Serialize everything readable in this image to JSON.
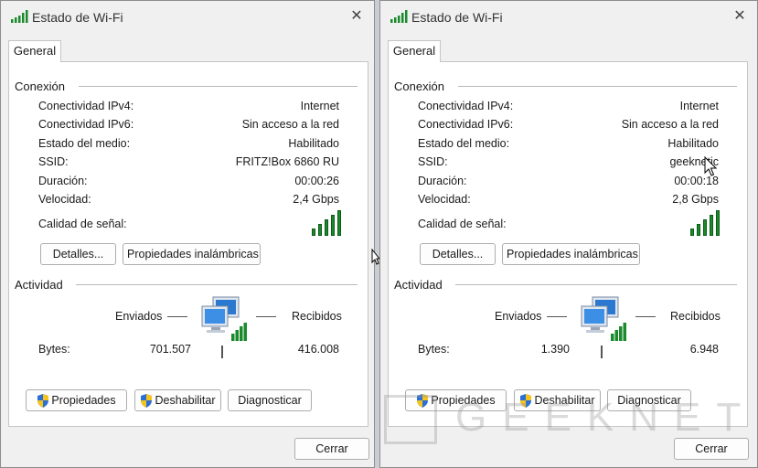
{
  "dialogs": [
    {
      "title": "Estado de Wi-Fi",
      "tab": "General",
      "connection": {
        "group_label": "Conexión",
        "rows": [
          {
            "label": "Conectividad IPv4:",
            "value": "Internet"
          },
          {
            "label": "Conectividad IPv6:",
            "value": "Sin acceso a la red"
          },
          {
            "label": "Estado del medio:",
            "value": "Habilitado"
          },
          {
            "label": "SSID:",
            "value": "FRITZ!Box 6860 RU"
          },
          {
            "label": "Duración:",
            "value": "00:00:26"
          },
          {
            "label": "Velocidad:",
            "value": "2,4 Gbps"
          }
        ],
        "signal_label": "Calidad de señal:",
        "signal_bars": 5,
        "details_button": "Detalles...",
        "wireless_props_button": "Propiedades inalámbricas"
      },
      "activity": {
        "group_label": "Actividad",
        "sent_label": "Enviados",
        "received_label": "Recibidos",
        "bytes_label": "Bytes:",
        "bytes_sent": "701.507",
        "bytes_received": "416.008"
      },
      "buttons": {
        "properties": "Propiedades",
        "disable": "Deshabilitar",
        "diagnose": "Diagnosticar"
      },
      "close_button": "Cerrar"
    },
    {
      "title": "Estado de Wi-Fi",
      "tab": "General",
      "connection": {
        "group_label": "Conexión",
        "rows": [
          {
            "label": "Conectividad IPv4:",
            "value": "Internet"
          },
          {
            "label": "Conectividad IPv6:",
            "value": "Sin acceso a la red"
          },
          {
            "label": "Estado del medio:",
            "value": "Habilitado"
          },
          {
            "label": "SSID:",
            "value": "geeknetic"
          },
          {
            "label": "Duración:",
            "value": "00:00:18"
          },
          {
            "label": "Velocidad:",
            "value": "2,8 Gbps"
          }
        ],
        "signal_label": "Calidad de señal:",
        "signal_bars": 5,
        "details_button": "Detalles...",
        "wireless_props_button": "Propiedades inalámbricas"
      },
      "activity": {
        "group_label": "Actividad",
        "sent_label": "Enviados",
        "received_label": "Recibidos",
        "bytes_label": "Bytes:",
        "bytes_sent": "1.390",
        "bytes_received": "6.948"
      },
      "buttons": {
        "properties": "Propiedades",
        "disable": "Deshabilitar",
        "diagnose": "Diagnosticar"
      },
      "close_button": "Cerrar"
    }
  ],
  "watermark": "GEEKNETIC",
  "colors": {
    "signal": "#1a8a2c",
    "window_bg": "#f0f0f0",
    "panel_bg": "#ffffff"
  }
}
